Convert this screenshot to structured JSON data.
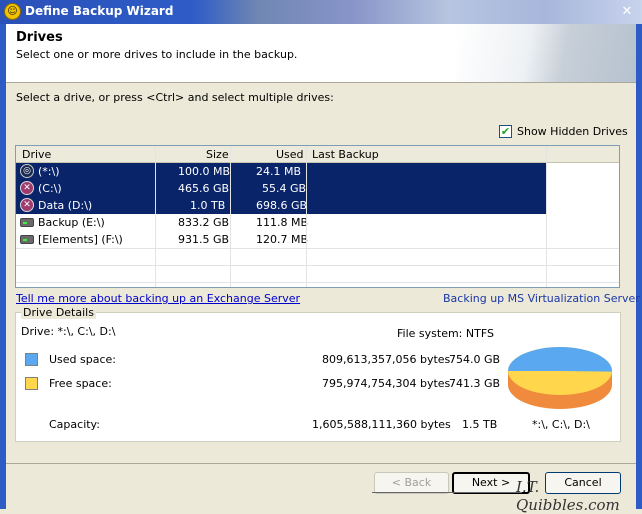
{
  "window": {
    "title": "Define Backup Wizard",
    "close_glyph": "✕"
  },
  "header": {
    "title": "Drives",
    "subtitle": "Select one or more drives to include in the backup."
  },
  "instruction": "Select a drive, or press <Ctrl> and select multiple drives:",
  "show_hidden": {
    "label": "Show Hidden Drives",
    "checked": true
  },
  "drive_table": {
    "columns": [
      "Drive",
      "Size",
      "Used",
      "Last Backup"
    ],
    "rows": [
      {
        "icon": "windows-drive-icon",
        "drive": "(*:\\)",
        "size": "100.0 MB",
        "used": "24.1 MB",
        "last": "",
        "selected": true
      },
      {
        "icon": "error-drive-icon",
        "drive": "(C:\\)",
        "size": "465.6 GB",
        "used": "55.4 GB",
        "last": "",
        "selected": true
      },
      {
        "icon": "error-drive-icon",
        "drive": "Data (D:\\)",
        "size": "1.0 TB",
        "used": "698.6 GB",
        "last": "",
        "selected": true
      },
      {
        "icon": "usb-drive-icon",
        "drive": "Backup (E:\\)",
        "size": "833.2 GB",
        "used": "111.8 MB",
        "last": "",
        "selected": false
      },
      {
        "icon": "usb-drive-icon",
        "drive": "[Elements] (F:\\)",
        "size": "931.5 GB",
        "used": "120.7 MB",
        "last": "",
        "selected": false
      }
    ]
  },
  "links": {
    "exchange": "Tell me more about backing up an Exchange Server",
    "virtualization": "Backing up MS Virtualization Server"
  },
  "details": {
    "legend": "Drive Details",
    "drive_list": "Drive: *:\\, C:\\, D:\\",
    "file_system": "File system: NTFS",
    "used": {
      "label": "Used space:",
      "bytes": "809,613,357,056 bytes",
      "size": "754.0 GB",
      "color": "#5aa8f0"
    },
    "free": {
      "label": "Free space:",
      "bytes": "795,974,754,304 bytes",
      "size": "741.3 GB",
      "color": "#ffd64c"
    },
    "capacity": {
      "label": "Capacity:",
      "bytes": "1,605,588,111,360 bytes",
      "size": "1.5 TB"
    },
    "pie_label": "*:\\, C:\\, D:\\",
    "pie_used_fraction": 0.504
  },
  "buttons": {
    "back": "< Back",
    "next": "Next >",
    "cancel": "Cancel"
  },
  "watermark": "I.T. Quibbles.com"
}
